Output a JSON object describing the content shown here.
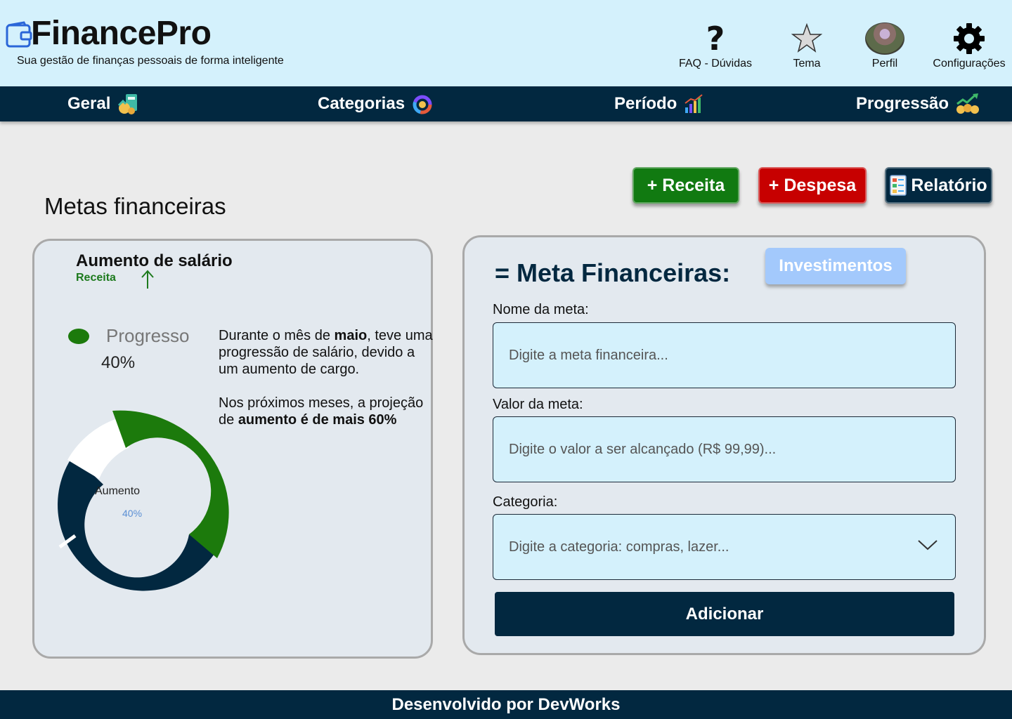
{
  "header": {
    "brand": "FinancePro",
    "tagline": "Sua gestão de finanças pessoais de forma inteligente",
    "items": [
      {
        "label": "FAQ - Dúvidas",
        "icon": "question-icon"
      },
      {
        "label": "Tema",
        "icon": "star-icon"
      },
      {
        "label": "Perfil",
        "icon": "avatar"
      },
      {
        "label": "Configurações",
        "icon": "gear-icon"
      }
    ]
  },
  "nav": {
    "items": [
      {
        "label": "Geral",
        "icon": "money-icon"
      },
      {
        "label": "Categorias",
        "icon": "category-icon"
      },
      {
        "label": "Período",
        "icon": "bar-chart-icon"
      },
      {
        "label": "Progressão",
        "icon": "growth-icon"
      }
    ]
  },
  "actions": {
    "receita": "+ Receita",
    "despesa": "+ Despesa",
    "relatorio": "Relatório"
  },
  "section_title": "Metas financeiras",
  "goal_card": {
    "title": "Aumento de salário",
    "type": "Receita",
    "legend_label": "Progresso",
    "legend_value": "40%",
    "desc1_a": "Durante o mês de ",
    "desc1_b": "maio",
    "desc1_c": ", teve uma progressão de salário, devido a um aumento de cargo.",
    "desc2_a": "Nos próximos meses, a projeção de ",
    "desc2_b": "aumento é de mais 60%",
    "donut_label": "Aumento",
    "donut_value": "40%",
    "progress": 0.4
  },
  "form": {
    "title": "= Meta Financeiras:",
    "chip": "Investimentos",
    "name_label": "Nome da meta:",
    "name_placeholder": "Digite a meta financeira...",
    "value_label": "Valor da meta:",
    "value_placeholder": "Digite o valor a ser alcançado (R$ 99,99)...",
    "category_label": "Categoria:",
    "category_placeholder": "Digite a categoria: compras, lazer...",
    "submit": "Adicionar"
  },
  "footer": "Desenvolvido por DevWorks",
  "colors": {
    "header_bg": "#d4f1fc",
    "navy": "#022840",
    "green": "#117a11",
    "red": "#c70000",
    "chip": "#a3c9fc"
  }
}
